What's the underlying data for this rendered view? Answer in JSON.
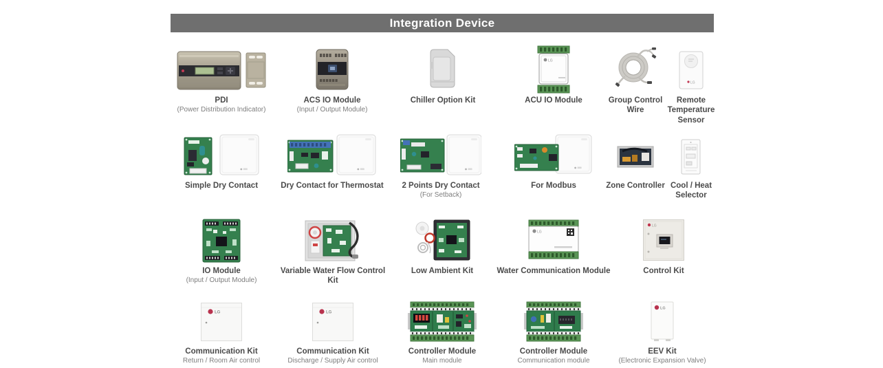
{
  "header": {
    "title": "Integration Device"
  },
  "colors": {
    "header_bg": "#6f6f6f",
    "header_text": "#ffffff",
    "label": "#4a4a4a",
    "sublabel": "#7d7d7d",
    "pcb_green": "#35804e",
    "terminal_green": "#5a9556",
    "lg_red": "#b8334e"
  },
  "rows": [
    {
      "items": [
        {
          "label": "PDI",
          "sublabel": "(Power Distribution Indicator)",
          "icon": "pdi"
        },
        {
          "label": "ACS IO Module",
          "sublabel": "(Input / Output Module)",
          "icon": "acs-io-module"
        },
        {
          "label": "Chiller Option Kit",
          "sublabel": "",
          "icon": "chiller-option-kit"
        },
        {
          "label": "ACU IO Module",
          "sublabel": "",
          "icon": "acu-io-module"
        },
        {
          "label": "Group Control Wire",
          "sublabel": "",
          "icon": "group-control-wire"
        },
        {
          "label": "Remote Temperature Sensor",
          "sublabel": "",
          "icon": "remote-temperature-sensor"
        }
      ]
    },
    {
      "items": [
        {
          "label": "Simple Dry Contact",
          "sublabel": "",
          "icon": "simple-dry-contact"
        },
        {
          "label": "Dry Contact for Thermostat",
          "sublabel": "",
          "icon": "dry-contact-thermostat"
        },
        {
          "label": "2 Points Dry Contact",
          "sublabel": "(For Setback)",
          "icon": "two-points-dry-contact"
        },
        {
          "label": "For Modbus",
          "sublabel": "",
          "icon": "modbus"
        },
        {
          "label": "Zone Controller",
          "sublabel": "",
          "icon": "zone-controller"
        },
        {
          "label": "Cool / Heat Selector",
          "sublabel": "",
          "icon": "cool-heat-selector"
        }
      ]
    },
    {
      "items": [
        {
          "label": "IO Module",
          "sublabel": "(Input / Output Module)",
          "icon": "io-module"
        },
        {
          "label": "Variable Water Flow Control Kit",
          "sublabel": "",
          "icon": "variable-water-flow-control-kit"
        },
        {
          "label": "Low Ambient Kit",
          "sublabel": "",
          "icon": "low-ambient-kit"
        },
        {
          "label": "Water Communication Module",
          "sublabel": "",
          "icon": "water-communication-module"
        },
        {
          "label": "Control Kit",
          "sublabel": "",
          "icon": "control-kit"
        }
      ]
    },
    {
      "items": [
        {
          "label": "Communication Kit",
          "sublabel": "Return / Room Air control",
          "icon": "communication-kit-return"
        },
        {
          "label": "Communication Kit",
          "sublabel": "Discharge / Supply Air control",
          "icon": "communication-kit-discharge"
        },
        {
          "label": "Controller Module",
          "sublabel": "Main module",
          "icon": "controller-module-main"
        },
        {
          "label": "Controller Module",
          "sublabel": "Communication module",
          "icon": "controller-module-communication"
        },
        {
          "label": "EEV Kit",
          "sublabel": "(Electronic Expansion Valve)",
          "icon": "eev-kit"
        }
      ]
    }
  ]
}
